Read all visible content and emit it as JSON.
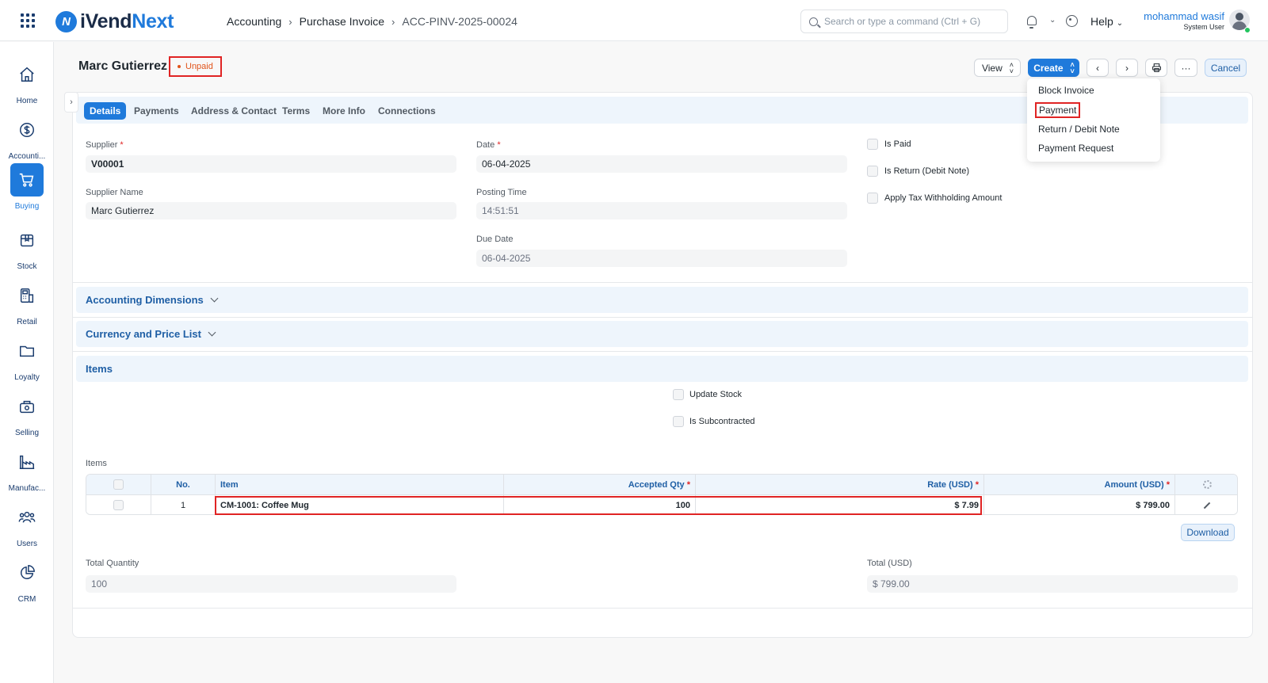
{
  "topbar": {
    "logo_prefix": "iVend",
    "logo_suffix": "Next",
    "breadcrumbs": [
      "Accounting",
      "Purchase Invoice",
      "ACC-PINV-2025-00024"
    ],
    "search_placeholder": "Search or type a command (Ctrl + G)",
    "help_label": "Help",
    "user_name": "mohammad wasif",
    "user_role": "System User"
  },
  "sidebar": {
    "items": [
      {
        "label": "Home",
        "icon": "home-icon"
      },
      {
        "label": "Accounti...",
        "icon": "dollar-icon"
      },
      {
        "label": "Buying",
        "icon": "cart-icon",
        "active": true
      },
      {
        "label": "Stock",
        "icon": "box-icon"
      },
      {
        "label": "Retail",
        "icon": "pos-icon"
      },
      {
        "label": "Loyalty",
        "icon": "folder-icon"
      },
      {
        "label": "Selling",
        "icon": "bag-icon"
      },
      {
        "label": "Manufac...",
        "icon": "factory-icon"
      },
      {
        "label": "Users",
        "icon": "users-icon"
      },
      {
        "label": "CRM",
        "icon": "pie-icon"
      }
    ]
  },
  "header": {
    "title": "Marc Gutierrez",
    "status": "Unpaid",
    "view_label": "View",
    "create_label": "Create",
    "more_label": "···",
    "cancel_label": "Cancel"
  },
  "create_menu": {
    "items": [
      "Block Invoice",
      "Payment",
      "Return / Debit Note",
      "Payment Request"
    ],
    "highlighted": "Payment"
  },
  "tabs": [
    "Details",
    "Payments",
    "Address & Contact",
    "Terms",
    "More Info",
    "Connections"
  ],
  "details": {
    "supplier_label": "Supplier",
    "supplier_value": "V00001",
    "supplier_name_label": "Supplier Name",
    "supplier_name_value": "Marc Gutierrez",
    "date_label": "Date",
    "date_value": "06-04-2025",
    "posting_time_label": "Posting Time",
    "posting_time_value": "14:51:51",
    "due_date_label": "Due Date",
    "due_date_value": "06-04-2025",
    "is_paid_label": "Is Paid",
    "is_return_label": "Is Return (Debit Note)",
    "apply_tax_label": "Apply Tax Withholding Amount"
  },
  "sections": {
    "accounting_dimensions": "Accounting Dimensions",
    "currency_price_list": "Currency and Price List",
    "items": "Items"
  },
  "items_section": {
    "update_stock_label": "Update Stock",
    "is_subcontracted_label": "Is Subcontracted",
    "table_label": "Items",
    "columns": {
      "no": "No.",
      "item": "Item",
      "accepted_qty": "Accepted Qty",
      "rate": "Rate (USD)",
      "amount": "Amount (USD)"
    },
    "rows": [
      {
        "no": "1",
        "item": "CM-1001: Coffee Mug",
        "accepted_qty": "100",
        "rate": "$ 7.99",
        "amount": "$ 799.00"
      }
    ],
    "download_label": "Download"
  },
  "totals": {
    "total_quantity_label": "Total Quantity",
    "total_quantity_value": "100",
    "total_label": "Total (USD)",
    "total_value": "$ 799.00"
  },
  "colors": {
    "accent": "#1f7adb",
    "highlight": "#e02424",
    "status": "#e0541b"
  }
}
